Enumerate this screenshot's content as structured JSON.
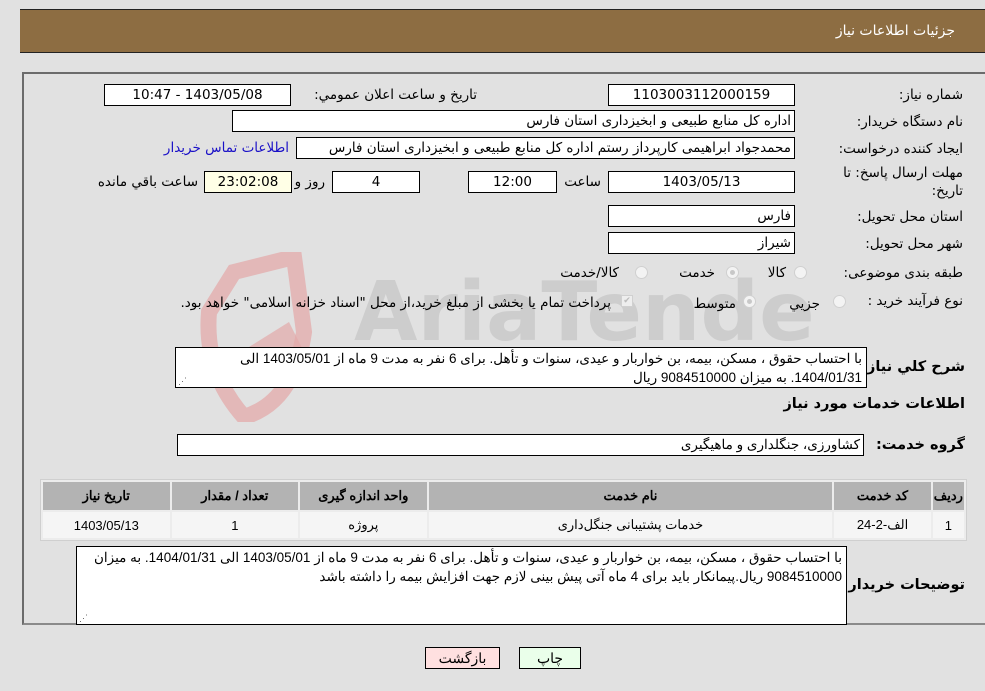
{
  "header": {
    "title": "جزئیات اطلاعات نیاز"
  },
  "form": {
    "need_number": {
      "label": "شماره نیاز:",
      "value": "1103003112000159"
    },
    "announce_datetime": {
      "label": "تاریخ و ساعت اعلان عمومي:",
      "value": "1403/05/08 - 10:47"
    },
    "buyer_org": {
      "label": "نام دستگاه خريدار:",
      "value": "اداره کل منابع طبیعی و ابخیزداری استان فارس"
    },
    "requester": {
      "label": "ایجاد کننده درخواست:",
      "value": "محمدجواد ابراهیمی کارپرداز رستم اداره کل منابع طبیعی و ابخیزداری استان فارس",
      "contact_link": "اطلاعات تماس خريدار"
    },
    "deadline": {
      "label_line1": "مهلت ارسال پاسخ: تا",
      "label_line2": "تاریخ:",
      "date": "1403/05/13",
      "time_label": "ساعت",
      "time": "12:00",
      "days": "4",
      "days_label": "روز و",
      "remaining": "23:02:08",
      "remaining_label": "ساعت باقي مانده"
    },
    "delivery_province": {
      "label": "استان محل تحويل:",
      "value": "فارس"
    },
    "delivery_city": {
      "label": "شهر محل تحويل:",
      "value": "شیراز"
    },
    "category": {
      "label": "طبقه بندی موضوعی:",
      "options": [
        {
          "label": "کالا",
          "selected": false
        },
        {
          "label": "خدمت",
          "selected": true
        },
        {
          "label": "کالا/خدمت",
          "selected": false
        }
      ]
    },
    "purchase_type": {
      "label": "نوع فرآیند خرید :",
      "options": [
        {
          "label": "جزيي",
          "selected": false
        },
        {
          "label": "متوسط",
          "selected": true
        }
      ],
      "treasury_checkbox": {
        "label": "پرداخت تمام یا بخشی از مبلغ خرید،از محل \"اسناد خزانه اسلامی\" خواهد بود.",
        "checked": true
      }
    },
    "general_description": {
      "label": "شرح کلي نياز:",
      "value": "با احتساب حقوق ، مسکن، بیمه، بن خواربار و عیدی، سنوات و تأهل. برای 6 نفر به مدت 9 ماه از 1403/05/01 الی  1404/01/31. به میزان 9084510000 ریال"
    }
  },
  "services": {
    "section_title": "اطلاعات خدمات مورد نیاز",
    "group_label": "گروه خدمت:",
    "group_value": "کشاورزی، جنگلداری و ماهیگیری",
    "table": {
      "columns": [
        "رديف",
        "کد خدمت",
        "نام خدمت",
        "واحد اندازه گیری",
        "تعداد / مقدار",
        "تاریخ نیاز"
      ],
      "rows": [
        [
          "1",
          "الف-2-24",
          "خدمات پشتیبانی جنگل‌داری",
          "پروژه",
          "1",
          "1403/05/13"
        ]
      ]
    }
  },
  "buyer_notes": {
    "label": "توضیحات خریدار:",
    "value": "با احتساب حقوق ، مسکن، بیمه، بن خواربار و عیدی، سنوات و تأهل. برای 6 نفر به مدت 9 ماه از 1403/05/01 الی 1404/01/31. به میزان 9084510000 ریال.پیمانکار باید برای 4 ماه آتی پیش بینی لازم جهت افزایش بیمه را داشته باشد"
  },
  "buttons": {
    "print": "چاپ",
    "back": "بازگشت"
  },
  "colors": {
    "header_bg": "#8d6d42",
    "print_bg": "#eaffea",
    "back_bg": "#ffe0e0",
    "link": "#1a10c7"
  }
}
